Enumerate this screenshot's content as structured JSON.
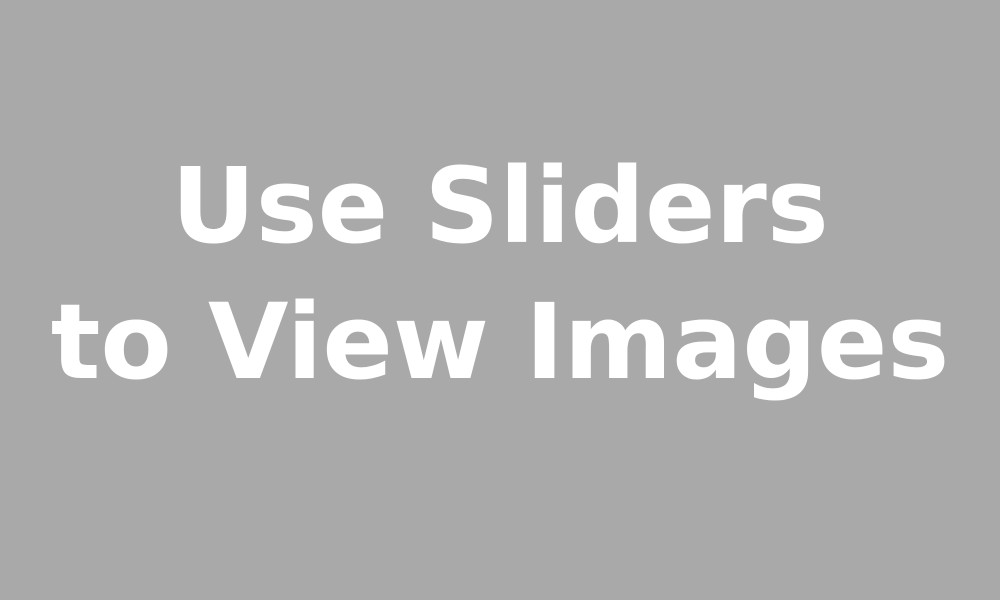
{
  "placeholder": {
    "background_color": "#a9a9a9",
    "text_color": "#ffffff",
    "message_lines": [
      "Use Sliders",
      "to View Images"
    ]
  }
}
